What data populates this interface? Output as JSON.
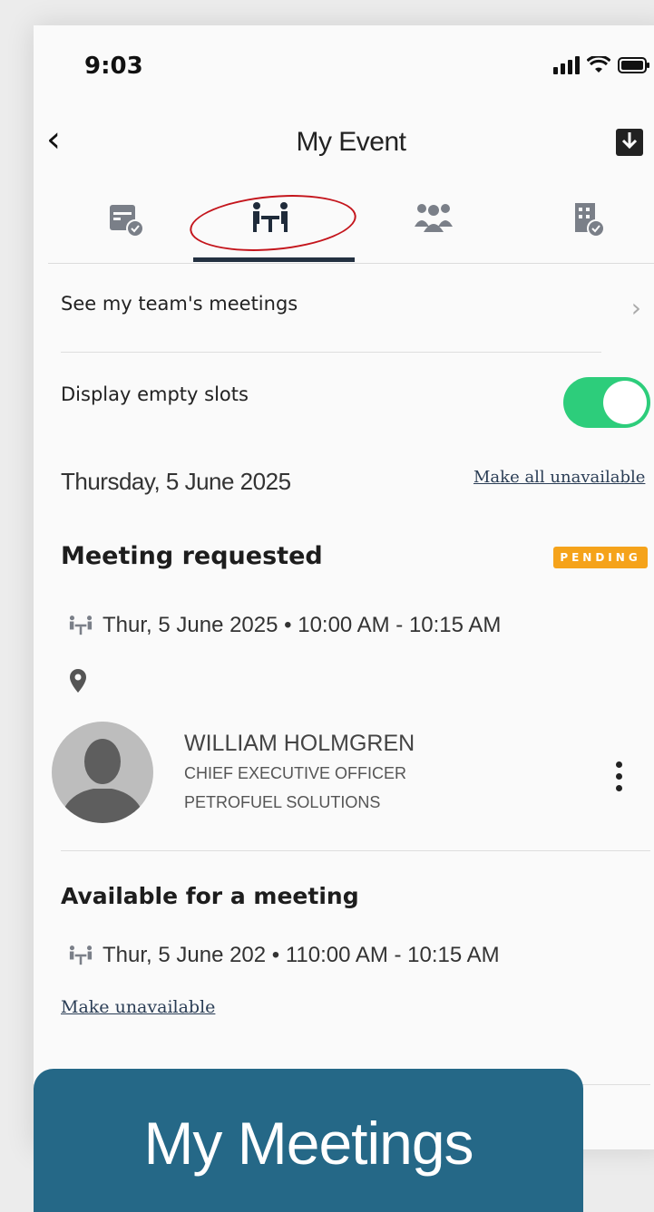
{
  "status_bar": {
    "time": "9:03"
  },
  "nav": {
    "title": "My Event"
  },
  "tabs": [
    {
      "icon": "calendar-check-icon"
    },
    {
      "icon": "meeting-table-icon",
      "active": true
    },
    {
      "icon": "people-icon"
    },
    {
      "icon": "building-check-icon"
    }
  ],
  "rows": {
    "team_meetings": "See my team's meetings",
    "empty_slots": "Display empty slots",
    "empty_slots_on": true
  },
  "day": {
    "date": "Thursday, 5 June 2025",
    "make_all_unavailable": "Make all unavailable"
  },
  "meeting_requested": {
    "title": "Meeting requested",
    "badge": "PENDING",
    "when": "Thur, 5 June 2025 • 10:00 AM - 10:15 AM",
    "person": {
      "name": "WILLIAM HOLMGREN",
      "role": "CHIEF EXECUTIVE OFFICER",
      "company": "PETROFUEL SOLUTIONS"
    }
  },
  "available": {
    "title": "Available for a meeting",
    "when": "Thur, 5 June 202 • 110:00 AM - 10:15 AM",
    "make_unavailable": "Make unavailable"
  },
  "banner": {
    "text": "My Meetings"
  },
  "colors": {
    "toggle_on": "#2dcd7b",
    "badge": "#f5a31a",
    "banner": "#256887",
    "annotation": "#c4151c"
  }
}
